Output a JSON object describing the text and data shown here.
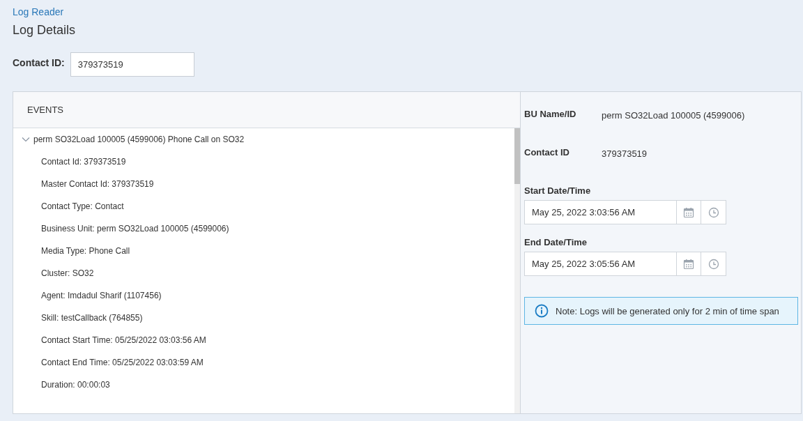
{
  "breadcrumb": "Log Reader",
  "title": "Log Details",
  "contact_field": {
    "label": "Contact ID:",
    "value": "379373519"
  },
  "events": {
    "heading": "EVENTS",
    "tree": [
      {
        "label": "perm SO32Load 100005 (4599006) Phone Call on SO32",
        "expanded": true,
        "children": [
          {
            "label": "Contact Id: 379373519"
          },
          {
            "label": "Master Contact Id: 379373519"
          },
          {
            "label": "Contact Type: Contact"
          },
          {
            "label": "Business Unit: perm SO32Load 100005 (4599006)"
          },
          {
            "label": "Media Type: Phone Call"
          },
          {
            "label": "Cluster: SO32"
          },
          {
            "label": "Agent: Imdadul Sharif (1107456)"
          },
          {
            "label": "Skill: testCallback (764855)"
          },
          {
            "label": "Contact Start Time: 05/25/2022 03:03:56 AM"
          },
          {
            "label": "Contact End Time: 05/25/2022 03:03:59 AM"
          },
          {
            "label": "Duration: 00:00:03"
          }
        ]
      }
    ]
  },
  "details": [
    {
      "label": "BU Name/ID",
      "value": "perm SO32Load 100005 (4599006)"
    },
    {
      "label": "Contact ID",
      "value": "379373519"
    }
  ],
  "date_fields": [
    {
      "label": "Start Date/Time",
      "value": "May 25, 2022 3:03:56 AM"
    },
    {
      "label": "End Date/Time",
      "value": "May 25, 2022 3:05:56 AM"
    }
  ],
  "note": "Note: Logs will be generated only for 2 min of time span"
}
